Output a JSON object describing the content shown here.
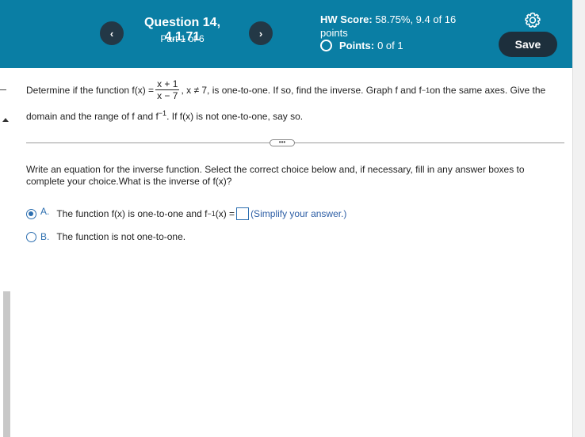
{
  "header": {
    "prev_label": "‹",
    "next_label": "›",
    "question_title": "Question 14, 4.1.71",
    "part": "Part 1 of 6",
    "hw_score_label": "HW Score:",
    "hw_score_value": "58.75%, 9.4 of 16",
    "hw_score_suffix": "points",
    "points_label": "Points:",
    "points_value": "0 of 1",
    "save_label": "Save",
    "settings_icon": "gear-icon"
  },
  "question": {
    "prefix": "Determine if the function f(x) =",
    "num": "x + 1",
    "den": "x − 7",
    "after_frac": ", x ≠ 7, is one-to-one.  If so, find the inverse. Graph f and f",
    "sup1": "−1",
    "tail1": " on the same axes. Give the",
    "line2_a": "domain and the range of f and f",
    "sup2": "−1",
    "line2_b": ".  If f(x) is not one-to-one, say so."
  },
  "more_button": "•••",
  "instructions": "Write an equation for the inverse function. Select the correct choice below and, if necessary, fill in any answer boxes to complete your choice.What is the inverse of f(x)?",
  "choices": {
    "a_letter": "A.",
    "a_text_before": "The function f(x) is one-to-one and f",
    "a_sup": "−1",
    "a_text_after": "(x) =",
    "a_hint": "(Simplify your answer.)",
    "b_letter": "B.",
    "b_text": "The function is not one-to-one.",
    "selected": "A"
  },
  "colors": {
    "header_bg": "#0a7ea4",
    "nav_button": "#233846",
    "save_button": "#1d2f3c",
    "accent_blue": "#2d6fb0"
  }
}
